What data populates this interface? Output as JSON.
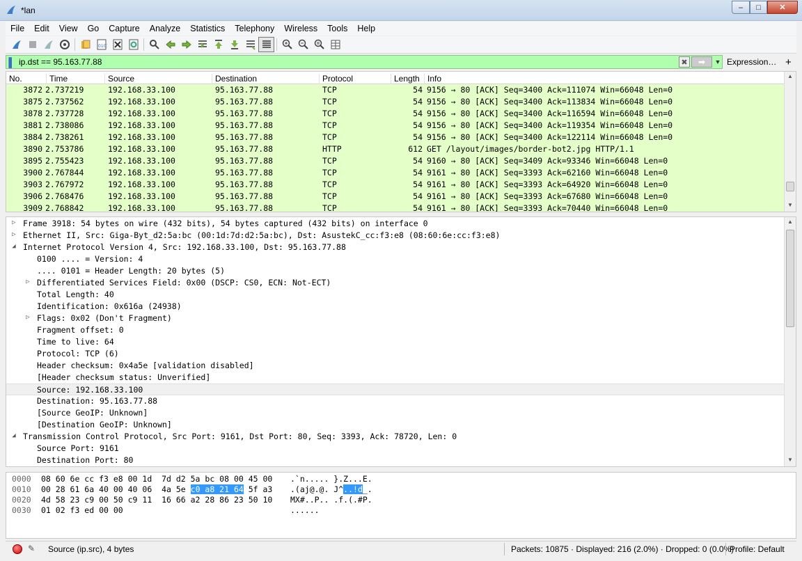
{
  "window": {
    "title": "*lan"
  },
  "window_buttons": {
    "minimize": "–",
    "maximize": "□",
    "close": "✕"
  },
  "menu": [
    "File",
    "Edit",
    "View",
    "Go",
    "Capture",
    "Analyze",
    "Statistics",
    "Telephony",
    "Wireless",
    "Tools",
    "Help"
  ],
  "toolbar_icons": [
    "shark-fin-start-icon",
    "stop-capture-icon",
    "restart-capture-icon",
    "capture-options-icon",
    "open-file-icon",
    "save-file-icon",
    "close-file-icon",
    "reload-file-icon",
    "find-packet-icon",
    "go-back-icon",
    "go-forward-icon",
    "go-to-packet-icon",
    "first-packet-icon",
    "last-packet-icon",
    "auto-scroll-icon",
    "colorize-icon",
    "zoom-in-icon",
    "zoom-out-icon",
    "normal-size-icon",
    "resize-columns-icon"
  ],
  "filter": {
    "value": "ip.dst == 95.163.77.88",
    "expression_label": "Expression…",
    "plus": "+",
    "clear_glyph": "✖",
    "apply_glyph": "➡",
    "dropdown_glyph": "▼",
    "bookmark_glyph": "▌",
    "color": "#afffaf"
  },
  "packet_list": {
    "columns": {
      "no": "No.",
      "time": "Time",
      "source": "Source",
      "destination": "Destination",
      "protocol": "Protocol",
      "length": "Length",
      "info": "Info"
    },
    "rows": [
      {
        "no": "3872",
        "time": "2.737219",
        "source": "192.168.33.100",
        "destination": "95.163.77.88",
        "protocol": "TCP",
        "length": "54",
        "info": "9156 → 80 [ACK] Seq=3400 Ack=111074 Win=66048 Len=0"
      },
      {
        "no": "3875",
        "time": "2.737562",
        "source": "192.168.33.100",
        "destination": "95.163.77.88",
        "protocol": "TCP",
        "length": "54",
        "info": "9156 → 80 [ACK] Seq=3400 Ack=113834 Win=66048 Len=0"
      },
      {
        "no": "3878",
        "time": "2.737728",
        "source": "192.168.33.100",
        "destination": "95.163.77.88",
        "protocol": "TCP",
        "length": "54",
        "info": "9156 → 80 [ACK] Seq=3400 Ack=116594 Win=66048 Len=0"
      },
      {
        "no": "3881",
        "time": "2.738086",
        "source": "192.168.33.100",
        "destination": "95.163.77.88",
        "protocol": "TCP",
        "length": "54",
        "info": "9156 → 80 [ACK] Seq=3400 Ack=119354 Win=66048 Len=0"
      },
      {
        "no": "3884",
        "time": "2.738261",
        "source": "192.168.33.100",
        "destination": "95.163.77.88",
        "protocol": "TCP",
        "length": "54",
        "info": "9156 → 80 [ACK] Seq=3400 Ack=122114 Win=66048 Len=0"
      },
      {
        "no": "3890",
        "time": "2.753786",
        "source": "192.168.33.100",
        "destination": "95.163.77.88",
        "protocol": "HTTP",
        "length": "612",
        "info": "GET /layout/images/border-bot2.jpg HTTP/1.1"
      },
      {
        "no": "3895",
        "time": "2.755423",
        "source": "192.168.33.100",
        "destination": "95.163.77.88",
        "protocol": "TCP",
        "length": "54",
        "info": "9160 → 80 [ACK] Seq=3409 Ack=93346 Win=66048 Len=0"
      },
      {
        "no": "3900",
        "time": "2.767844",
        "source": "192.168.33.100",
        "destination": "95.163.77.88",
        "protocol": "TCP",
        "length": "54",
        "info": "9161 → 80 [ACK] Seq=3393 Ack=62160 Win=66048 Len=0"
      },
      {
        "no": "3903",
        "time": "2.767972",
        "source": "192.168.33.100",
        "destination": "95.163.77.88",
        "protocol": "TCP",
        "length": "54",
        "info": "9161 → 80 [ACK] Seq=3393 Ack=64920 Win=66048 Len=0"
      },
      {
        "no": "3906",
        "time": "2.768476",
        "source": "192.168.33.100",
        "destination": "95.163.77.88",
        "protocol": "TCP",
        "length": "54",
        "info": "9161 → 80 [ACK] Seq=3393 Ack=67680 Win=66048 Len=0"
      },
      {
        "no": "3909",
        "time": "2.768842",
        "source": "192.168.33.100",
        "destination": "95.163.77.88",
        "protocol": "TCP",
        "length": "54",
        "info": "9161 → 80 [ACK] Seq=3393 Ack=70440 Win=66048 Len=0"
      }
    ],
    "row_color": "#e4ffc7"
  },
  "details": [
    {
      "text": "Frame 3918: 54 bytes on wire (432 bits), 54 bytes captured (432 bits) on interface 0",
      "twisty": "▷",
      "level": 0
    },
    {
      "text": "Ethernet II, Src: Giga-Byt_d2:5a:bc (00:1d:7d:d2:5a:bc), Dst: AsustekC_cc:f3:e8 (08:60:6e:cc:f3:e8)",
      "twisty": "▷",
      "level": 0
    },
    {
      "text": "Internet Protocol Version 4, Src: 192.168.33.100, Dst: 95.163.77.88",
      "twisty": "◢",
      "level": 0
    },
    {
      "text": "0100 .... = Version: 4",
      "twisty": "",
      "level": 1
    },
    {
      "text": ".... 0101 = Header Length: 20 bytes (5)",
      "twisty": "",
      "level": 1
    },
    {
      "text": "Differentiated Services Field: 0x00 (DSCP: CS0, ECN: Not-ECT)",
      "twisty": "▷",
      "level": 1
    },
    {
      "text": "Total Length: 40",
      "twisty": "",
      "level": 1
    },
    {
      "text": "Identification: 0x616a (24938)",
      "twisty": "",
      "level": 1
    },
    {
      "text": "Flags: 0x02 (Don't Fragment)",
      "twisty": "▷",
      "level": 1
    },
    {
      "text": "Fragment offset: 0",
      "twisty": "",
      "level": 1
    },
    {
      "text": "Time to live: 64",
      "twisty": "",
      "level": 1
    },
    {
      "text": "Protocol: TCP (6)",
      "twisty": "",
      "level": 1
    },
    {
      "text": "Header checksum: 0x4a5e [validation disabled]",
      "twisty": "",
      "level": 1
    },
    {
      "text": "[Header checksum status: Unverified]",
      "twisty": "",
      "level": 1
    },
    {
      "text": "Source: 192.168.33.100",
      "twisty": "",
      "level": 1,
      "selected": true
    },
    {
      "text": "Destination: 95.163.77.88",
      "twisty": "",
      "level": 1
    },
    {
      "text": "[Source GeoIP: Unknown]",
      "twisty": "",
      "level": 1
    },
    {
      "text": "[Destination GeoIP: Unknown]",
      "twisty": "",
      "level": 1
    },
    {
      "text": "Transmission Control Protocol, Src Port: 9161, Dst Port: 80, Seq: 3393, Ack: 78720, Len: 0",
      "twisty": "◢",
      "level": 0
    },
    {
      "text": "Source Port: 9161",
      "twisty": "",
      "level": 1
    },
    {
      "text": "Destination Port: 80",
      "twisty": "",
      "level": 1
    }
  ],
  "bytes": [
    {
      "offset": "0000",
      "hex_pre": "08 60 6e cc f3 e8 00 1d  7d d2 5a bc 08 00 45 00",
      "hex_hl": "",
      "hex_post": "",
      "ascii_pre": ".`n..... }.Z...E.",
      "ascii_hl": "",
      "ascii_post": ""
    },
    {
      "offset": "0010",
      "hex_pre": "00 28 61 6a 40 00 40 06  4a 5e ",
      "hex_hl": "c0 a8 21 64",
      "hex_post": " 5f a3",
      "ascii_pre": ".(aj@.@. J^",
      "ascii_hl": "..!d",
      "ascii_post": "_."
    },
    {
      "offset": "0020",
      "hex_pre": "4d 58 23 c9 00 50 c9 11  16 66 a2 28 86 23 50 10",
      "hex_hl": "",
      "hex_post": "",
      "ascii_pre": "MX#..P.. .f.(.#P.",
      "ascii_hl": "",
      "ascii_post": ""
    },
    {
      "offset": "0030",
      "hex_pre": "01 02 f3 ed 00 00",
      "hex_hl": "",
      "hex_post": "",
      "ascii_pre": "......",
      "ascii_hl": "",
      "ascii_post": ""
    }
  ],
  "status": {
    "field": "Source (ip.src), 4 bytes",
    "packets": "Packets: 10875 · Displayed: 216 (2.0%) · Dropped: 0 (0.0%)",
    "profile": "Profile: Default",
    "edit_glyph": "✎"
  },
  "scroll_arrows": {
    "up": "▲",
    "down": "▼"
  }
}
